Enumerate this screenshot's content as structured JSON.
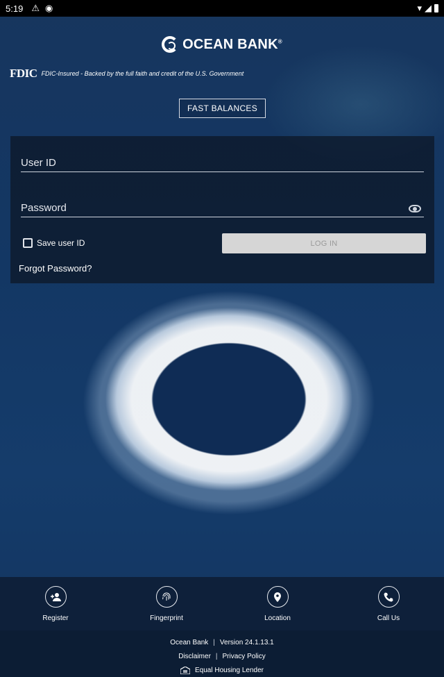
{
  "status_bar": {
    "time": "5:19",
    "icons": [
      "warning-icon",
      "sync-icon",
      "wifi-icon",
      "signal-icon",
      "battery-icon"
    ]
  },
  "brand": {
    "name": "OCEAN BANK",
    "registered": "®"
  },
  "fdic": {
    "logo": "FDIC",
    "text": "FDIC-Insured - Backed by the full faith and credit of the U.S. Government"
  },
  "fast_balances": {
    "label": "FAST BALANCES"
  },
  "login": {
    "user_id": {
      "placeholder": "User ID",
      "value": ""
    },
    "password": {
      "placeholder": "Password",
      "value": ""
    },
    "save_user_id": {
      "label": "Save user ID",
      "checked": false
    },
    "login_button": {
      "label": "LOG IN",
      "enabled": false
    },
    "forgot_password": "Forgot Password?"
  },
  "bottom_nav": [
    {
      "label": "Register",
      "icon": "add-person-icon"
    },
    {
      "label": "Fingerprint",
      "icon": "fingerprint-icon"
    },
    {
      "label": "Location",
      "icon": "location-pin-icon"
    },
    {
      "label": "Call Us",
      "icon": "phone-icon"
    }
  ],
  "footer": {
    "bank": "Ocean Bank",
    "separator": "|",
    "version": "Version 24.1.13.1",
    "disclaimer": "Disclaimer",
    "privacy": "Privacy Policy",
    "equal_housing": "Equal Housing Lender"
  },
  "colors": {
    "background": "#12305a",
    "panel": "#0d1a2c",
    "login_disabled": "#d6d6d6",
    "footer": "#0c1d34"
  }
}
